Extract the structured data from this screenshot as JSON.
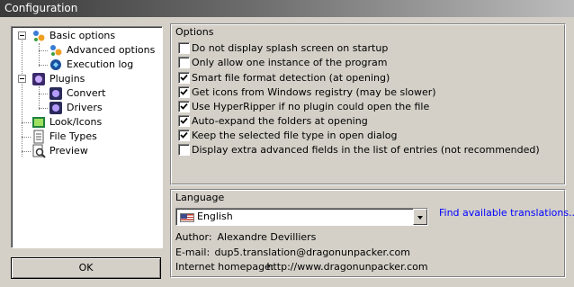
{
  "window": {
    "title": "Configuration"
  },
  "tree": {
    "items": [
      {
        "label": "Basic options",
        "icon": "gear-icon"
      },
      {
        "label": "Advanced options",
        "icon": "gear-icon"
      },
      {
        "label": "Execution log",
        "icon": "log-icon"
      },
      {
        "label": "Plugins",
        "icon": "plugin-icon"
      },
      {
        "label": "Convert",
        "icon": "convert-icon"
      },
      {
        "label": "Drivers",
        "icon": "drivers-icon"
      },
      {
        "label": "Look/Icons",
        "icon": "look-icon"
      },
      {
        "label": "File Types",
        "icon": "file-types-icon"
      },
      {
        "label": "Preview",
        "icon": "preview-icon"
      }
    ]
  },
  "ok_label": "OK",
  "options": {
    "title": "Options",
    "items": [
      {
        "label": "Do not display splash screen on startup",
        "checked": false
      },
      {
        "label": "Only allow one instance of the program",
        "checked": false
      },
      {
        "label": "Smart file format detection (at opening)",
        "checked": true
      },
      {
        "label": "Get icons from Windows registry (may be slower)",
        "checked": true
      },
      {
        "label": "Use HyperRipper if no plugin could open the file",
        "checked": true
      },
      {
        "label": "Auto-expand the folders at opening",
        "checked": true
      },
      {
        "label": "Keep the selected file type in open dialog",
        "checked": true
      },
      {
        "label": "Display extra advanced fields in the list of entries (not recommended)",
        "checked": false
      }
    ]
  },
  "language": {
    "title": "Language",
    "selected": "English",
    "flag_icon": "us-flag-icon",
    "find_link": "Find available translations...",
    "author_label": "Author:",
    "author_value": "Alexandre Devilliers",
    "email_label": "E-mail:",
    "email_value": "dup5.translation@dragonunpacker.com",
    "homepage_label": "Internet homepage:",
    "homepage_value": "http://www.dragonunpacker.com"
  }
}
